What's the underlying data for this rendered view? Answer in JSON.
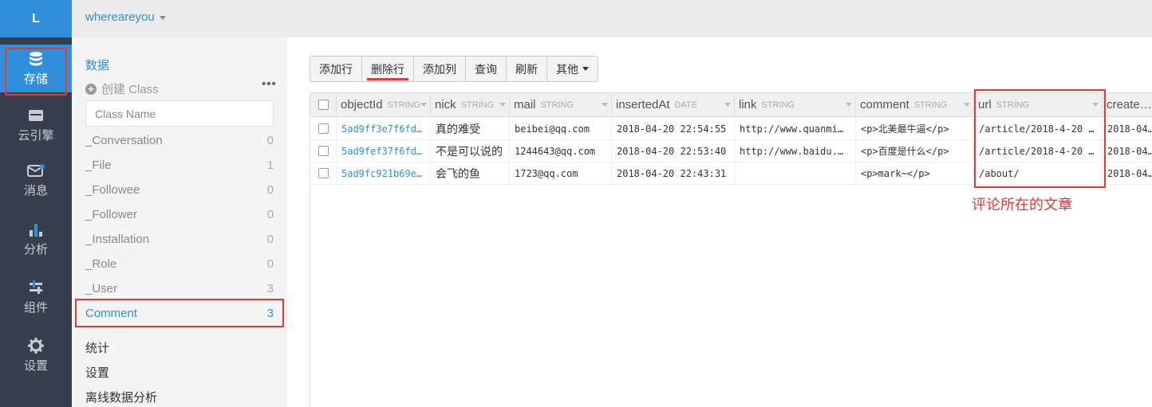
{
  "nav": {
    "logo": "L",
    "items": [
      {
        "label": "存储",
        "icon": "database-icon",
        "active": true
      },
      {
        "label": "云引擎",
        "icon": "server-icon",
        "active": false
      },
      {
        "label": "消息",
        "icon": "mail-icon",
        "active": false
      },
      {
        "label": "分析",
        "icon": "bar-chart-icon",
        "active": false
      },
      {
        "label": "组件",
        "icon": "sliders-icon",
        "active": false
      },
      {
        "label": "设置",
        "icon": "gear-icon",
        "active": false
      }
    ]
  },
  "header": {
    "app_name": "whereareyou"
  },
  "sidebar": {
    "section_data": "数据",
    "create_class": "创建 Class",
    "more": "•••",
    "search_placeholder": "Class Name",
    "classes": [
      {
        "name": "_Conversation",
        "count": "0"
      },
      {
        "name": "_File",
        "count": "1"
      },
      {
        "name": "_Followee",
        "count": "0"
      },
      {
        "name": "_Follower",
        "count": "0"
      },
      {
        "name": "_Installation",
        "count": "0"
      },
      {
        "name": "_Role",
        "count": "0"
      },
      {
        "name": "_User",
        "count": "3"
      },
      {
        "name": "Comment",
        "count": "3",
        "active": true
      }
    ],
    "links": [
      "统计",
      "设置",
      "离线数据分析"
    ]
  },
  "toolbar": {
    "add_row": "添加行",
    "delete_row": "删除行",
    "add_column": "添加列",
    "query": "查询",
    "refresh": "刷新",
    "other": "其他"
  },
  "table": {
    "columns": [
      {
        "name": "objectId",
        "type": "STRING"
      },
      {
        "name": "nick",
        "type": "STRING"
      },
      {
        "name": "mail",
        "type": "STRING"
      },
      {
        "name": "insertedAt",
        "type": "DATE"
      },
      {
        "name": "link",
        "type": "STRING"
      },
      {
        "name": "comment",
        "type": "STRING"
      },
      {
        "name": "url",
        "type": "STRING"
      },
      {
        "name": "create…",
        "type": ""
      }
    ],
    "rows": [
      [
        "5ad9ff3e7f6fd…",
        "真的难受",
        "beibei@qq.com",
        "2018-04-20 22:54:55",
        "http://www.quanmi…",
        "<p>北美最牛逼</p>",
        "/article/2018-4-20 …",
        "2018-04…"
      ],
      [
        "5ad9fef37f6fd…",
        "不是可以说的",
        "1244643@qq.com",
        "2018-04-20 22:53:40",
        "http://www.baidu.…",
        "<p>百度是什么</p>",
        "/article/2018-4-20 …",
        "2018-04…"
      ],
      [
        "5ad9fc921b69e…",
        "会飞的鱼",
        "1723@qq.com",
        "2018-04-20 22:43:31",
        "",
        "<p>mark~</p>",
        "/about/",
        "2018-04…"
      ]
    ]
  },
  "annotation": "评论所在的文章",
  "colors": {
    "accent": "#2f8fdc",
    "highlight": "#e53935",
    "nav_bg": "#373e4c"
  }
}
